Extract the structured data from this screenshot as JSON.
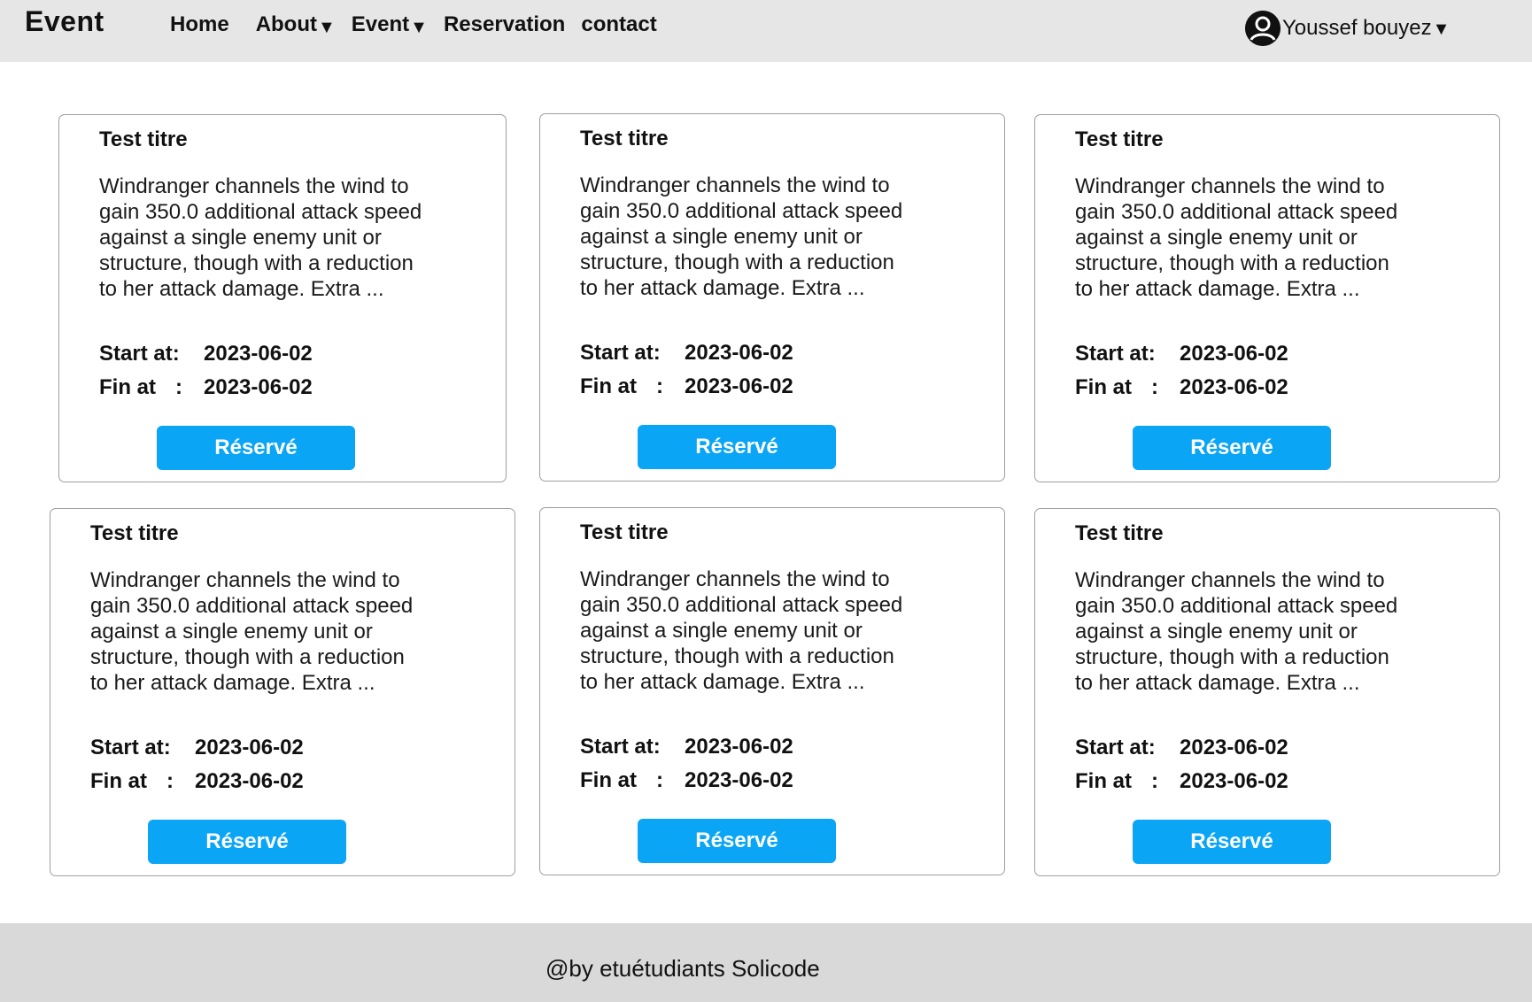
{
  "brand": "Event",
  "nav": {
    "home": "Home",
    "about": "About",
    "event": "Event",
    "reservation": "Reservation",
    "contact": "contact",
    "caret": "▼"
  },
  "user": {
    "name": "Youssef bouyez",
    "caret": "▼",
    "icon": "user-avatar-icon"
  },
  "cards": [
    {
      "title": "Test titre",
      "description": "Windranger channels the wind to gain 350.0 additional attack speed against a single enemy unit or structure, though with a reduction to her attack damage. Extra ...",
      "start_label": "Start at:",
      "start": "2023-06-02",
      "end_label": "Fin at",
      "sep": ":",
      "end": "2023-06-02",
      "button": "Réservé"
    },
    {
      "title": "Test titre",
      "description": "Windranger channels the wind to gain 350.0 additional attack speed against a single enemy unit or structure, though with a reduction to her attack damage. Extra ...",
      "start_label": "Start at:",
      "start": "2023-06-02",
      "end_label": "Fin at",
      "sep": ":",
      "end": "2023-06-02",
      "button": "Réservé"
    },
    {
      "title": "Test titre",
      "description": "Windranger channels the wind to gain 350.0 additional attack speed against a single enemy unit or structure, though with a reduction to her attack damage. Extra ...",
      "start_label": "Start at:",
      "start": "2023-06-02",
      "end_label": "Fin at",
      "sep": ":",
      "end": "2023-06-02",
      "button": "Réservé"
    },
    {
      "title": "Test titre",
      "description": "Windranger channels the wind to gain 350.0 additional attack speed against a single enemy unit or structure, though with a reduction to her attack damage. Extra ...",
      "start_label": "Start at:",
      "start": "2023-06-02",
      "end_label": "Fin at",
      "sep": ":",
      "end": "2023-06-02",
      "button": "Réservé"
    },
    {
      "title": "Test titre",
      "description": "Windranger channels the wind to gain 350.0 additional attack speed against a single enemy unit or structure, though with a reduction to her attack damage. Extra ...",
      "start_label": "Start at:",
      "start": "2023-06-02",
      "end_label": "Fin at",
      "sep": ":",
      "end": "2023-06-02",
      "button": "Réservé"
    },
    {
      "title": "Test titre",
      "description": "Windranger channels the wind to gain 350.0 additional attack speed against a single enemy unit or structure, though with a reduction to her attack damage. Extra ...",
      "start_label": "Start at:",
      "start": "2023-06-02",
      "end_label": "Fin at",
      "sep": ":",
      "end": "2023-06-02",
      "button": "Réservé"
    }
  ],
  "footer": {
    "text": "@by etuétudiants Solicode"
  },
  "colors": {
    "accent": "#0aa5f5",
    "navbar": "#e6e6e6",
    "footer": "#d9d9d9"
  }
}
